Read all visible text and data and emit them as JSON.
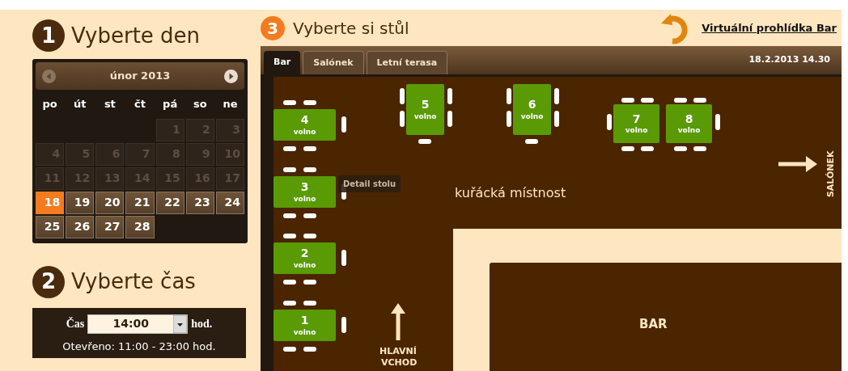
{
  "day_step": {
    "number": "1",
    "title": "Vyberte den"
  },
  "calendar": {
    "month": "únor 2013",
    "weekdays": [
      "po",
      "út",
      "st",
      "čt",
      "pá",
      "so",
      "ne"
    ],
    "days": [
      {
        "label": "1",
        "disabled": true,
        "selected": false
      },
      {
        "label": "2",
        "disabled": true,
        "selected": false
      },
      {
        "label": "3",
        "disabled": true,
        "selected": false
      },
      {
        "label": "4",
        "disabled": true,
        "selected": false
      },
      {
        "label": "5",
        "disabled": true,
        "selected": false
      },
      {
        "label": "6",
        "disabled": true,
        "selected": false
      },
      {
        "label": "7",
        "disabled": true,
        "selected": false
      },
      {
        "label": "8",
        "disabled": true,
        "selected": false
      },
      {
        "label": "9",
        "disabled": true,
        "selected": false
      },
      {
        "label": "10",
        "disabled": true,
        "selected": false
      },
      {
        "label": "11",
        "disabled": true,
        "selected": false
      },
      {
        "label": "12",
        "disabled": true,
        "selected": false
      },
      {
        "label": "13",
        "disabled": true,
        "selected": false
      },
      {
        "label": "14",
        "disabled": true,
        "selected": false
      },
      {
        "label": "15",
        "disabled": true,
        "selected": false
      },
      {
        "label": "16",
        "disabled": true,
        "selected": false
      },
      {
        "label": "17",
        "disabled": true,
        "selected": false
      },
      {
        "label": "18",
        "disabled": false,
        "selected": true
      },
      {
        "label": "19",
        "disabled": false,
        "selected": false
      },
      {
        "label": "20",
        "disabled": false,
        "selected": false
      },
      {
        "label": "21",
        "disabled": false,
        "selected": false
      },
      {
        "label": "22",
        "disabled": false,
        "selected": false
      },
      {
        "label": "23",
        "disabled": false,
        "selected": false
      },
      {
        "label": "24",
        "disabled": false,
        "selected": false
      },
      {
        "label": "25",
        "disabled": false,
        "selected": false
      },
      {
        "label": "26",
        "disabled": false,
        "selected": false
      },
      {
        "label": "27",
        "disabled": false,
        "selected": false
      },
      {
        "label": "28",
        "disabled": false,
        "selected": false
      }
    ]
  },
  "time_step": {
    "number": "2",
    "title": "Vyberte čas"
  },
  "time": {
    "label": "Čas",
    "value": "14:00",
    "unit": "hod.",
    "note": "Otevřeno: 11:00 - 23:00 hod."
  },
  "table_step": {
    "number": "3",
    "title": "Vyberte si stůl"
  },
  "virtual_tour": "Virtuální prohlídka Bar",
  "tabs": [
    {
      "label": "Bar",
      "selected": true
    },
    {
      "label": "Salónek",
      "selected": false
    },
    {
      "label": "Letní terasa",
      "selected": false
    }
  ],
  "datetime": "18.2.2013 14.30",
  "tables": [
    {
      "number": "4",
      "status": "volno"
    },
    {
      "number": "5",
      "status": "volno"
    },
    {
      "number": "6",
      "status": "volno"
    },
    {
      "number": "7",
      "status": "volno"
    },
    {
      "number": "8",
      "status": "volno"
    },
    {
      "number": "3",
      "status": "volno"
    },
    {
      "number": "2",
      "status": "volno"
    },
    {
      "number": "1",
      "status": "volno"
    }
  ],
  "tooltip": "Detail stolu",
  "labels": {
    "smoking_room": "kuřácká místnost",
    "bar": "BAR",
    "entrance_line_1": "HLAVNÍ",
    "entrance_line_2": "VCHOD",
    "side_room": "SALÓNEK"
  }
}
